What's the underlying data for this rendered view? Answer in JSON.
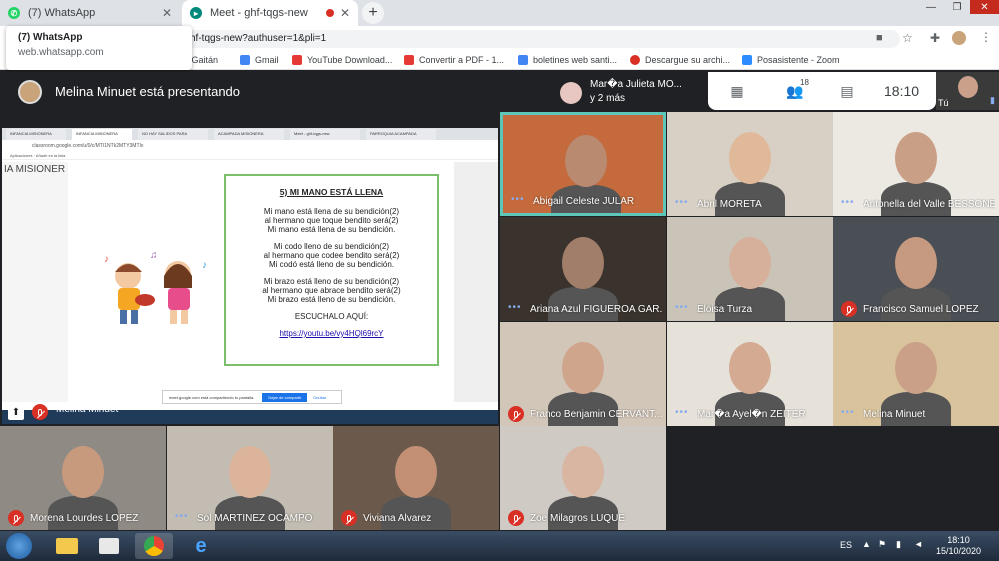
{
  "browser": {
    "tabs": [
      {
        "title": "(7) WhatsApp",
        "badge": "7"
      },
      {
        "title": "Meet - ghf-tqgs-new"
      }
    ],
    "new_tab_symbol": "+",
    "url": "hf-tqgs-new?authuser=1&pli=1",
    "tooltip": {
      "title": "(7) WhatsApp",
      "domain": "web.whatsapp.com"
    },
    "bookmarks": [
      {
        "label": "a Gaitán",
        "icon": "folder-icon"
      },
      {
        "label": "Gmail",
        "icon": "google-icon"
      },
      {
        "label": "YouTube Download...",
        "icon": "youtube-icon"
      },
      {
        "label": "Convertir a PDF - 1...",
        "icon": "pdf-icon"
      },
      {
        "label": "boletines web santi...",
        "icon": "google-icon"
      },
      {
        "label": "Descargue su archi...",
        "icon": "block-icon"
      },
      {
        "label": "Posasistente - Zoom",
        "icon": "zoom-icon"
      }
    ]
  },
  "meet": {
    "presenting_text": "Melina Minuet está presentando",
    "chip_name": "Mar�a Julieta MO...",
    "chip_more": "y 2 más",
    "participant_count": "18",
    "time": "18:10",
    "self_label": "Tú"
  },
  "presentation": {
    "presenter_name": "Melina Minuet",
    "shared_tabs": [
      "INFANCIA MISIONERA",
      "INFANCIA MISIONERA",
      "NO HAY SALIDOS PARA",
      "ACAMPADA MISIONERA",
      "Meet - ghf-tqgs-new",
      "PARROQUIA ACAMPADA"
    ],
    "shared_url": "classroom.google.com/u/0/c/MTI1NTk2MTY3MTIx",
    "shared_bookmarks": "Aplicaciones  ·  Añadir en la lista",
    "page_heading": "IA MISIONER",
    "doc": {
      "title": "5) MI MANO ESTÁ LLENA",
      "verses": [
        [
          "Mi mano está llena de su bendición(2)",
          "al hermano que toque bendito será(2)",
          "Mi mano está llena de su bendición."
        ],
        [
          "Mi codo lleno de su bendición(2)",
          "al hermano que codee bendito será(2)",
          "Mi codó está lleno de su bendición."
        ],
        [
          "Mi brazo está lleno de su bendición(2)",
          "al hermano que abrace bendito será(2)",
          "Mi brazo está lleno de su bendición."
        ]
      ],
      "listen": "ESCUCHALO AQUÍ:",
      "link": "https://youtu.be/vy4HQl69rcY"
    },
    "share_bar": {
      "text": "meet.google.com está compartiendo tu pantalla.",
      "stop": "Dejar de compartir",
      "hide": "Ocultar"
    }
  },
  "participants": [
    {
      "name": "Abigail Celeste JULAR",
      "muted": false,
      "active": true,
      "skin": "#b98a70",
      "bg": "#c46a3c"
    },
    {
      "name": "Abril MORETA",
      "muted": false,
      "skin": "#e0b89a",
      "bg": "#d8d0c4"
    },
    {
      "name": "Antonella del Valle BESSONE",
      "muted": false,
      "skin": "#c99f85",
      "bg": "#ece8e2"
    },
    {
      "name": "Ariana Azul FIGUEROA GAR...",
      "muted": false,
      "skin": "#a17e6a",
      "bg": "#3a332d"
    },
    {
      "name": "Eloisa Turza",
      "muted": false,
      "skin": "#d7b09b",
      "bg": "#c9c3b8"
    },
    {
      "name": "Francisco Samuel LOPEZ",
      "muted": true,
      "skin": "#c59a80",
      "bg": "#4a4e55"
    },
    {
      "name": "Franco Benjamin CERVANT...",
      "muted": true,
      "skin": "#cfa58c",
      "bg": "#d2c6b8"
    },
    {
      "name": "Mar�a Ayel�n ZEITER",
      "muted": false,
      "skin": "#d4ab92",
      "bg": "#e6e2da"
    },
    {
      "name": "Melina Minuet",
      "muted": false,
      "skin": "#caa088",
      "bg": "#d9c39c"
    },
    {
      "name": "Morena Lourdes LOPEZ",
      "muted": true,
      "skin": "#c79a7e",
      "bg": "#8f8a84"
    },
    {
      "name": "Sol MARTINEZ OCAMPO",
      "muted": false,
      "skin": "#dcb49c",
      "bg": "#c2bcb2"
    },
    {
      "name": "Viviana Alvarez",
      "muted": true,
      "skin": "#c39076",
      "bg": "#6b5a4c"
    },
    {
      "name": "Zoe Milagros LUQUE",
      "muted": true,
      "skin": "#d9b6a2",
      "bg": "#cfcac4"
    }
  ],
  "taskbar": {
    "language": "ES",
    "time": "18:10",
    "date": "15/10/2020"
  },
  "colors": {
    "meet_bg": "#202124",
    "active_speaker": "#5ec6b8",
    "muted_red": "#d93025",
    "doc_border": "#7bbf6a"
  }
}
